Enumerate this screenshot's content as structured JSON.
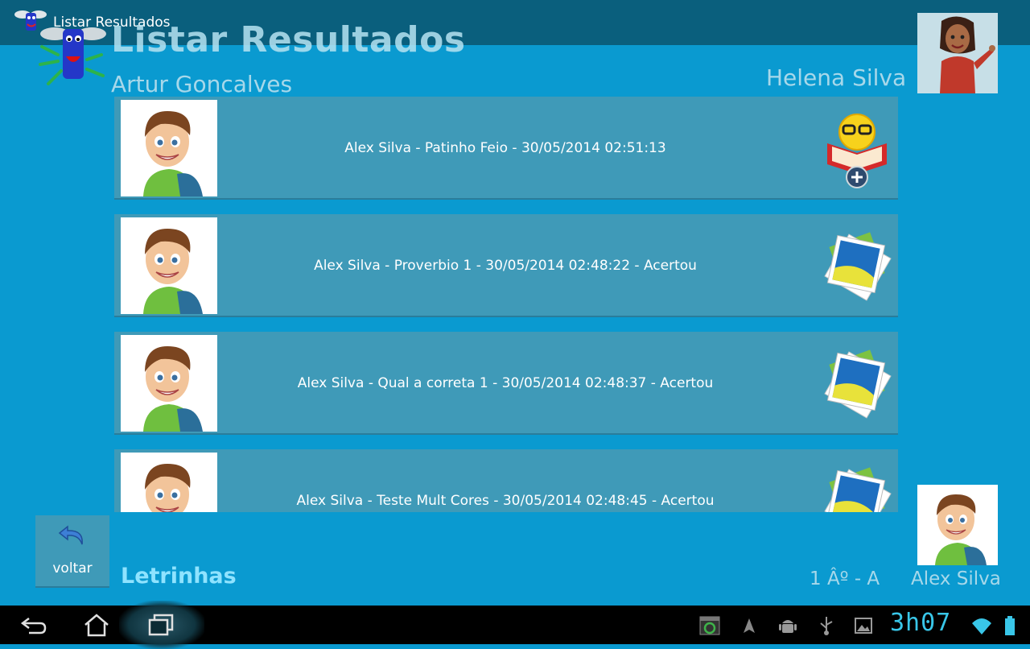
{
  "action_bar": {
    "title": "Listar Resultados",
    "app_icon": "letrinhas-logo-icon"
  },
  "header": {
    "page_title": "Listar Resultados",
    "teacher_name_left": "Artur Goncalves",
    "teacher_name_right": "Helena Silva",
    "teacher_avatar": "teacher-avatar"
  },
  "results": [
    {
      "text": "Alex Silva - Patinho Feio - 30/05/2014 02:51:13",
      "icon": "reading-smiley-icon"
    },
    {
      "text": "Alex Silva - Proverbio 1 - 30/05/2014 02:48:22 - Acertou",
      "icon": "picture-stack-icon"
    },
    {
      "text": "Alex Silva - Qual a correta 1 - 30/05/2014 02:48:37 - Acertou",
      "icon": "picture-stack-icon"
    },
    {
      "text": "Alex Silva - Teste Mult Cores - 30/05/2014 02:48:45 - Acertou",
      "icon": "picture-stack-icon"
    }
  ],
  "footer": {
    "back_label": "voltar",
    "app_name": "Letrinhas",
    "class_label": "1 Âº - A",
    "student_name": "Alex Silva"
  },
  "system_bar": {
    "clock": "3h07",
    "icons": [
      "back-icon",
      "home-icon",
      "recent-apps-icon",
      "screenshot-icon",
      "navigation-icon",
      "android-debug-icon",
      "usb-icon",
      "gallery-icon",
      "wifi-icon",
      "battery-icon"
    ]
  },
  "colors": {
    "background": "#0a9ad0",
    "action_bar": "#0a5f7d",
    "row": "#3f9ab8",
    "app_name": "#8fe3ff",
    "clock": "#39c6e8"
  }
}
